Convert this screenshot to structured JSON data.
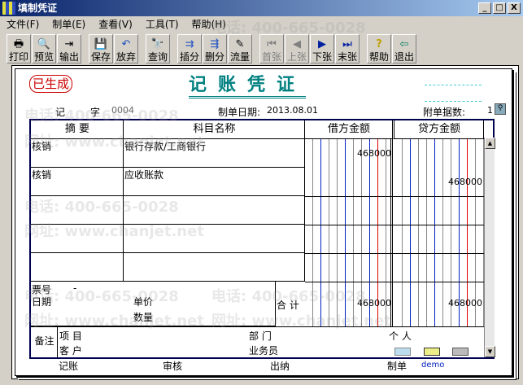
{
  "window": {
    "title": "填制凭证",
    "controls": [
      "_",
      "□",
      "X"
    ]
  },
  "menu": [
    "文件(F)",
    "制单(E)",
    "查看(V)",
    "工具(T)",
    "帮助(H)"
  ],
  "toolbar": [
    {
      "label": "打印",
      "icon": "🖶"
    },
    {
      "label": "预览",
      "icon": "🔍"
    },
    {
      "label": "输出",
      "icon": "⇥"
    },
    {
      "label": "保存",
      "icon": "💾"
    },
    {
      "label": "放弃",
      "icon": "↶"
    },
    {
      "label": "查询",
      "icon": "🔭"
    },
    {
      "label": "插分",
      "icon": "⇉"
    },
    {
      "label": "删分",
      "icon": "⇶"
    },
    {
      "label": "流量",
      "icon": "✎"
    },
    {
      "label": "首张",
      "icon": "⏮"
    },
    {
      "label": "上张",
      "icon": "◀"
    },
    {
      "label": "下张",
      "icon": "▶"
    },
    {
      "label": "末张",
      "icon": "⏭"
    },
    {
      "label": "帮助",
      "icon": "?"
    },
    {
      "label": "退出",
      "icon": "⇦"
    }
  ],
  "watermark": {
    "phone": "电话: 400-665-0028",
    "site": "网址: www.chanjet.net"
  },
  "voucher": {
    "status": "已生成",
    "title": "记账凭证",
    "type": "记",
    "zi": "字",
    "number": "0004",
    "date_label": "制单日期:",
    "date": "2013.08.01",
    "attach_label": "附单据数:",
    "attach": "1",
    "headers": {
      "summary": "摘 要",
      "account": "科目名称",
      "debit": "借方金额",
      "credit": "贷方金额"
    },
    "rows": [
      {
        "summary": "核销",
        "account": "银行存款/工商银行",
        "debit": "468000",
        "credit": ""
      },
      {
        "summary": "核销",
        "account": "应收账款",
        "debit": "",
        "credit": "468000"
      }
    ],
    "ticket_label": "票号",
    "ticket": "-",
    "date2_label": "日期",
    "price_label": "单价",
    "qty_label": "数量",
    "total_label": "合 计",
    "total_debit": "468000",
    "total_credit": "468000",
    "notes_label": "备注",
    "project_label": "项 目",
    "customer_label": "客 户",
    "dept_label": "部 门",
    "salesman_label": "业务员",
    "person_label": "个 人",
    "sign": {
      "post": "记账",
      "audit": "审核",
      "cashier": "出纳",
      "maker_label": "制单",
      "maker": "demo"
    }
  }
}
